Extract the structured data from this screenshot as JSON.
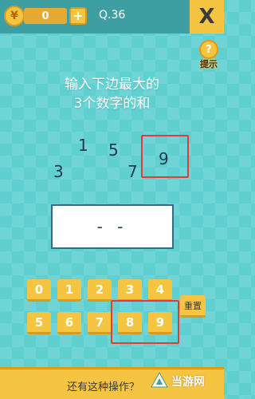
{
  "header": {
    "coin_icon": "¥",
    "coin_count": "0",
    "add_coins_label": "+",
    "level": "Q.36",
    "close_label": "X"
  },
  "hint": {
    "icon": "?",
    "label": "提示"
  },
  "question": {
    "line1": "输入下边最大的",
    "line2": "3个数字的和"
  },
  "numbers": [
    "1",
    "5",
    "3",
    "7",
    "9"
  ],
  "answer": {
    "display": "- -"
  },
  "keypad": {
    "keys": [
      "0",
      "1",
      "2",
      "3",
      "4",
      "5",
      "6",
      "7",
      "8",
      "9"
    ],
    "reset_label": "重置"
  },
  "footer": {
    "tip": "还有这种操作？"
  },
  "watermark": {
    "text": "当游网"
  },
  "colors": {
    "background": "#5fcfd0",
    "topbar": "#3d9fa2",
    "key": "#f5c542",
    "highlight": "#e53935",
    "number_text": "#1f3a55"
  }
}
